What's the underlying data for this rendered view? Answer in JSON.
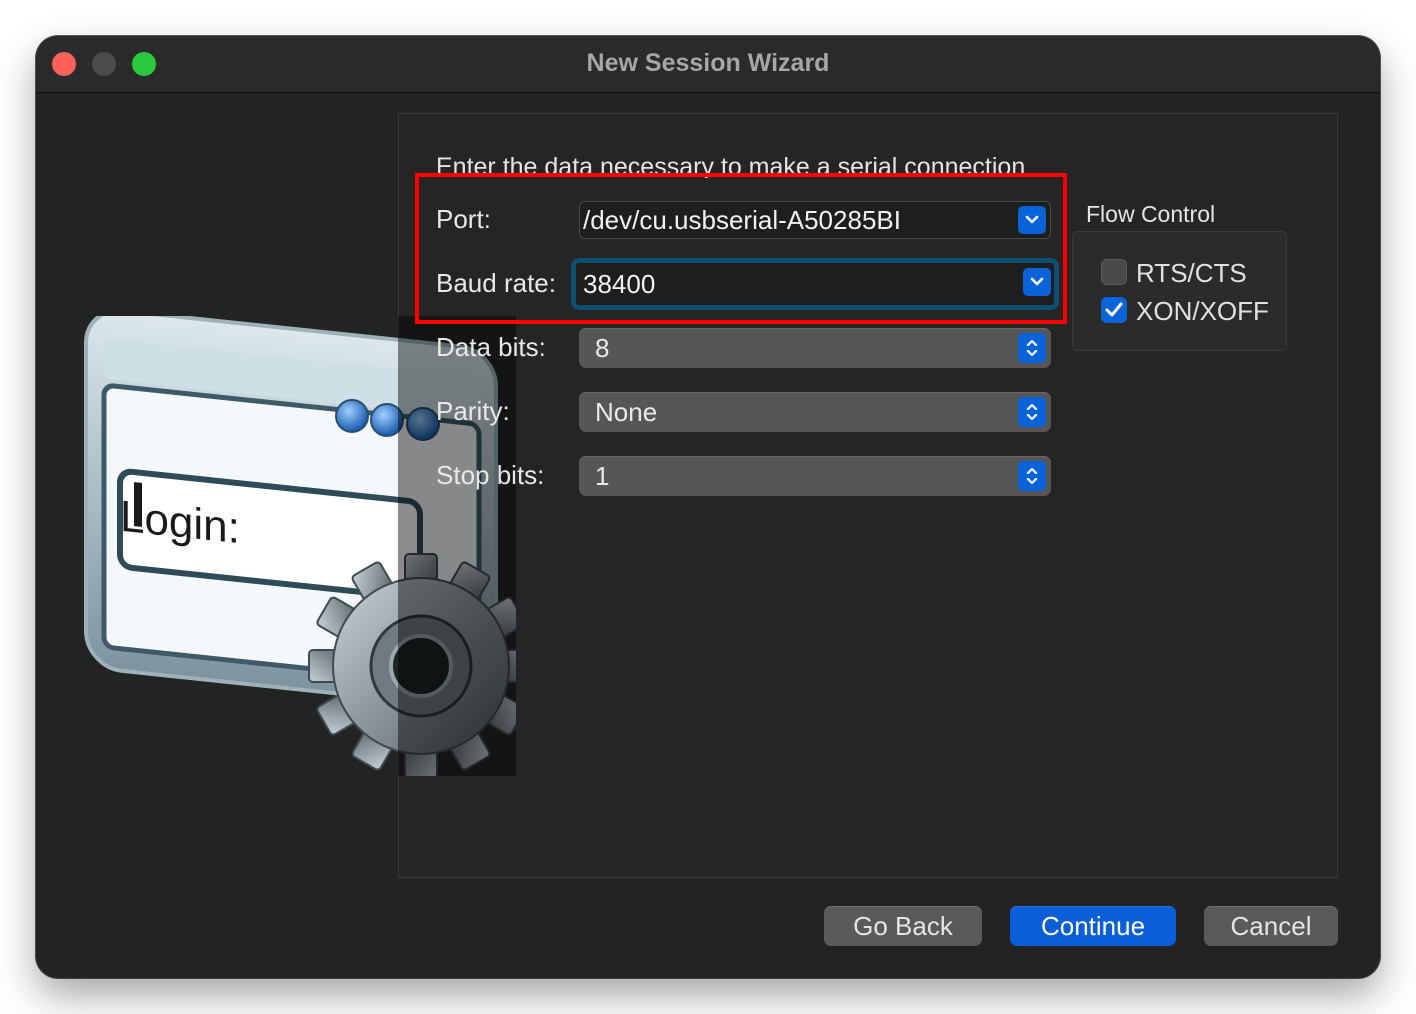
{
  "window": {
    "title": "New Session Wizard"
  },
  "panel": {
    "intro": "Enter the data necessary to make a serial connection"
  },
  "fields": {
    "port": {
      "label": "Port:",
      "value": "/dev/cu.usbserial-A50285BI"
    },
    "baud_rate": {
      "label": "Baud rate:",
      "value": "38400"
    },
    "data_bits": {
      "label": "Data bits:",
      "value": "8"
    },
    "parity": {
      "label": "Parity:",
      "value": "None"
    },
    "stop_bits": {
      "label": "Stop bits:",
      "value": "1"
    }
  },
  "flow_control": {
    "title": "Flow Control",
    "options": [
      {
        "label": "RTS/CTS",
        "checked": false
      },
      {
        "label": "XON/XOFF",
        "checked": true
      }
    ]
  },
  "illustration": {
    "text": "Login:"
  },
  "buttons": {
    "go_back": "Go Back",
    "continue": "Continue",
    "cancel": "Cancel"
  },
  "colors": {
    "accent": "#0a63d8",
    "highlight": "#ff0000",
    "focus_ring": "#0f4e73"
  }
}
